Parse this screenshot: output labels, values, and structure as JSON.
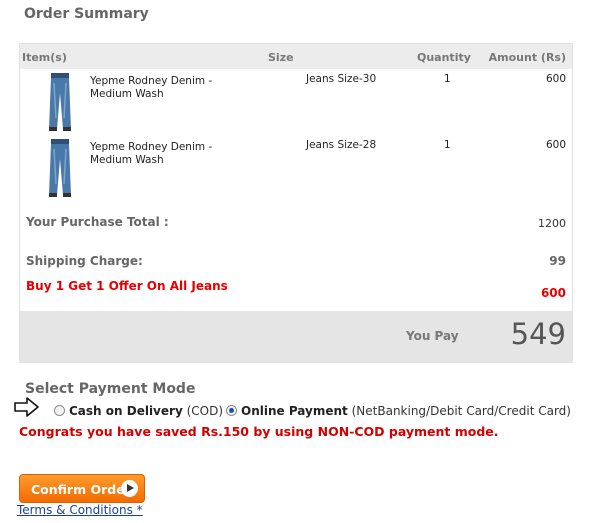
{
  "page_title": "Order Summary",
  "table": {
    "headers": {
      "item": "Item(s)",
      "size": "Size",
      "quantity": "Quantity",
      "amount": "Amount (Rs)"
    },
    "rows": [
      {
        "name": "Yepme Rodney Denim - Medium Wash",
        "size": "Jeans Size-30",
        "quantity": "1",
        "amount": "600"
      },
      {
        "name": "Yepme Rodney Denim - Medium Wash",
        "size": "Jeans Size-28",
        "quantity": "1",
        "amount": "600"
      }
    ],
    "purchase_total_label": "Your Purchase Total :",
    "purchase_total_value": "1200",
    "shipping_label": "Shipping Charge:",
    "shipping_value": "99",
    "offer_label": "Buy 1 Get 1 Offer On All Jeans",
    "offer_value": "600",
    "you_pay_label": "You Pay",
    "you_pay_value": "549"
  },
  "payment": {
    "title": "Select Payment Mode",
    "cod_label": "Cash on Delivery",
    "cod_note": "(COD)",
    "online_label": "Online Payment",
    "online_note": "(NetBanking/Debit Card/Credit Card)",
    "selected": "online",
    "congrats": "Congrats you have saved Rs.150 by using NON-COD payment mode."
  },
  "confirm_label": "Confirm Order",
  "terms_label": "Terms & Conditions *",
  "colors": {
    "accent_orange": "#f26b00",
    "offer_red": "#e60000",
    "link_blue": "#1a3fa0"
  }
}
